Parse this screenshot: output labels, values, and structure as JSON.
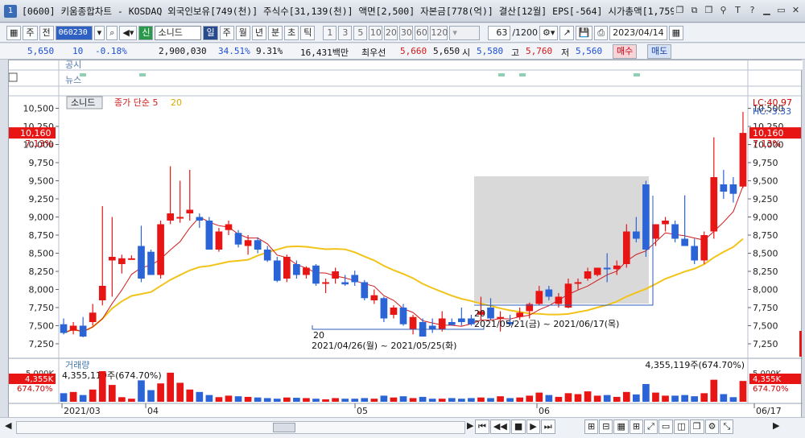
{
  "window": {
    "num": "1",
    "title": "[0600] 키움종합차트 - KOSDAQ 외국인보유[749(천)] 주식수[31,139(천)] 액면[2,500] 자본금[778(억)] 결산[12월] EPS[-564] 시가총액[1,759(억)]",
    "buttons": [
      "□",
      "▫",
      "▣",
      "⚑",
      "T",
      "?",
      "_",
      "▭",
      "×"
    ]
  },
  "toolbar": {
    "period_type": "주",
    "market": "전",
    "code": "060230",
    "name": "소니드",
    "name_tag": "신",
    "periods": [
      "일",
      "주",
      "월",
      "년",
      "분",
      "초",
      "틱"
    ],
    "intervals": [
      "1",
      "3",
      "5",
      "10",
      "20",
      "30",
      "60",
      "120"
    ],
    "count": "63",
    "count_total": "/1200",
    "date": "2023/04/14"
  },
  "quote": {
    "price": "5,650",
    "change": "10",
    "change_pct": "-0.18%",
    "volume": "2,900,030",
    "turnover_pct": "34.51%",
    "ratio": "9.31%",
    "amount": "16,431백만",
    "pref_label": "최우선",
    "pref_val1": "5,660",
    "pref_val2": "5,650",
    "open_label": "시",
    "open": "5,580",
    "high_label": "고",
    "high": "5,760",
    "low_label": "저",
    "low": "5,560",
    "buy": "매수",
    "sell": "매도"
  },
  "colors": {
    "up": "#e81515",
    "down": "#2a64d6",
    "ma5": "#d11b1b",
    "ma20": "#f2c318",
    "box": "#d9d9d9"
  },
  "chart_data": {
    "type": "candlestick",
    "title": "소니드",
    "indicator_label": "종가 단순",
    "ma_short_label": "5",
    "ma_long_label": "20",
    "pane_labels": {
      "notice": "공시",
      "news": "뉴스",
      "volume": "거래량"
    },
    "lc_label": "LC:40.97",
    "hc_label": "HC:-3.33",
    "current_price": "10,160",
    "current_pct": "7.13%",
    "volume_last": "4,355,119주(674.70%)",
    "volume_first": "4,355,119주(674.70%)",
    "volume_badge": "4,355K",
    "volume_badge_pct": "674.70%",
    "volume_axis_top": "5,000K",
    "ylim": [
      7050,
      10650
    ],
    "y_ticks": [
      "7,250",
      "7,500",
      "7,750",
      "8,000",
      "8,250",
      "8,500",
      "8,750",
      "9,000",
      "9,250",
      "9,500",
      "9,750",
      "10,000",
      "10,250",
      "10,500"
    ],
    "x_ticks": [
      "2021/03",
      "04",
      "05",
      "06",
      "06/17"
    ],
    "annotations": {
      "range1_count": "20",
      "range1": "2021/04/26(월) ~ 2021/05/25(화)",
      "range2_count": "20",
      "range2": "2021/05/21(금) ~ 2021/06/17(목)"
    },
    "ohlc": [
      [
        7520,
        7600,
        7380,
        7400
      ],
      [
        7430,
        7550,
        7380,
        7500
      ],
      [
        7500,
        7620,
        7340,
        7350
      ],
      [
        7550,
        7800,
        7500,
        7680
      ],
      [
        7850,
        9150,
        7780,
        8050
      ],
      [
        8400,
        9000,
        7900,
        8450
      ],
      [
        8350,
        8480,
        8220,
        8430
      ],
      [
        8430,
        8470,
        8420,
        8430
      ],
      [
        8600,
        8880,
        8100,
        8150
      ],
      [
        8520,
        8550,
        8200,
        8200
      ],
      [
        8200,
        8950,
        8150,
        8900
      ],
      [
        8950,
        9700,
        8900,
        9050
      ],
      [
        8980,
        9500,
        8920,
        9000
      ],
      [
        9050,
        9650,
        8950,
        9100
      ],
      [
        9000,
        9050,
        8850,
        8950
      ],
      [
        8950,
        9000,
        8550,
        8550
      ],
      [
        8550,
        8850,
        8520,
        8800
      ],
      [
        8820,
        8950,
        8750,
        8900
      ],
      [
        8780,
        8820,
        8580,
        8620
      ],
      [
        8600,
        8750,
        8480,
        8680
      ],
      [
        8680,
        8720,
        8500,
        8550
      ],
      [
        8550,
        8600,
        8380,
        8400
      ],
      [
        8400,
        8450,
        8100,
        8120
      ],
      [
        8150,
        8480,
        8100,
        8450
      ],
      [
        8350,
        8400,
        8150,
        8200
      ],
      [
        8200,
        8320,
        8150,
        8300
      ],
      [
        8330,
        8350,
        8050,
        8080
      ],
      [
        8080,
        8150,
        7950,
        8100
      ],
      [
        8150,
        8300,
        8080,
        8250
      ],
      [
        8100,
        8200,
        8050,
        8070
      ],
      [
        8200,
        8260,
        8050,
        8100
      ],
      [
        8100,
        8130,
        7850,
        7880
      ],
      [
        7850,
        8000,
        7800,
        7920
      ],
      [
        7880,
        7900,
        7550,
        7600
      ],
      [
        7650,
        7780,
        7600,
        7750
      ],
      [
        7750,
        7800,
        7500,
        7520
      ],
      [
        7450,
        7650,
        7380,
        7620
      ],
      [
        7550,
        7600,
        7350,
        7350
      ],
      [
        7500,
        7600,
        7400,
        7450
      ],
      [
        7450,
        7700,
        7420,
        7600
      ],
      [
        7550,
        7600,
        7500,
        7510
      ],
      [
        7600,
        7750,
        7500,
        7550
      ],
      [
        7600,
        7650,
        7500,
        7520
      ],
      [
        7650,
        7900,
        7580,
        7700
      ],
      [
        7750,
        7880,
        7580,
        7600
      ],
      [
        7600,
        7700,
        7420,
        7620
      ],
      [
        7550,
        7650,
        7500,
        7520
      ],
      [
        7620,
        7750,
        7580,
        7680
      ],
      [
        7700,
        7820,
        7600,
        7800
      ],
      [
        7800,
        8050,
        7780,
        7980
      ],
      [
        8000,
        8050,
        7850,
        7900
      ],
      [
        7800,
        7950,
        7750,
        7900
      ],
      [
        7750,
        8150,
        7740,
        8080
      ],
      [
        8080,
        8150,
        8000,
        8100
      ],
      [
        8150,
        8300,
        8120,
        8250
      ],
      [
        8200,
        8300,
        8180,
        8300
      ],
      [
        8300,
        8500,
        8100,
        8280
      ],
      [
        8280,
        8400,
        8200,
        8330
      ],
      [
        8350,
        8900,
        8300,
        8800
      ],
      [
        8800,
        9000,
        8650,
        8700
      ],
      [
        9450,
        9500,
        8450,
        8550
      ],
      [
        8700,
        8900,
        8600,
        8900
      ],
      [
        8900,
        9000,
        8800,
        8950
      ],
      [
        8900,
        8950,
        8650,
        8700
      ],
      [
        8700,
        9300,
        8600,
        8600
      ],
      [
        8600,
        8700,
        8350,
        8400
      ],
      [
        8400,
        8800,
        8350,
        8750
      ],
      [
        8800,
        10100,
        8700,
        9550
      ],
      [
        9450,
        9650,
        9250,
        9350
      ],
      [
        9450,
        9550,
        9200,
        9320
      ],
      [
        9420,
        10450,
        9400,
        10160
      ]
    ],
    "volumes": [
      0.28,
      0.32,
      0.22,
      0.4,
      1.0,
      0.55,
      0.15,
      0.1,
      0.7,
      0.38,
      0.6,
      0.95,
      0.62,
      0.4,
      0.32,
      0.22,
      0.15,
      0.2,
      0.18,
      0.16,
      0.14,
      0.12,
      0.1,
      0.14,
      0.13,
      0.12,
      0.1,
      0.08,
      0.12,
      0.1,
      0.1,
      0.12,
      0.1,
      0.2,
      0.14,
      0.18,
      0.12,
      0.16,
      0.1,
      0.1,
      0.12,
      0.1,
      0.12,
      0.14,
      0.12,
      0.18,
      0.12,
      0.14,
      0.2,
      0.3,
      0.22,
      0.16,
      0.28,
      0.25,
      0.34,
      0.2,
      0.22,
      0.16,
      0.32,
      0.24,
      0.58,
      0.3,
      0.2,
      0.2,
      0.22,
      0.18,
      0.28,
      0.72,
      0.25,
      0.15,
      0.68
    ]
  }
}
